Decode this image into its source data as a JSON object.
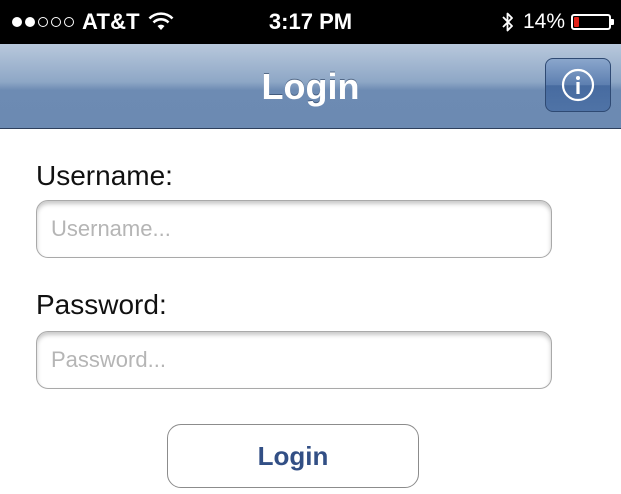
{
  "status_bar": {
    "carrier": "AT&T",
    "time": "3:17 PM",
    "battery_percent_label": "14%",
    "battery_level": 0.14,
    "signal_bars_filled": 2,
    "signal_bars_total": 5,
    "battery_color": "#e2231a",
    "icons": [
      "wifi-icon",
      "bluetooth-icon",
      "battery-icon"
    ]
  },
  "nav_bar": {
    "title": "Login",
    "info_button_icon": "info-icon"
  },
  "form": {
    "username_label": "Username:",
    "username_placeholder": "Username...",
    "username_value": "",
    "password_label": "Password:",
    "password_placeholder": "Password...",
    "password_value": "",
    "login_label": "Login"
  },
  "colors": {
    "nav_gradient_top": "#b8c8dc",
    "nav_gradient_bottom": "#6c8ab2",
    "login_text": "#324f85"
  }
}
